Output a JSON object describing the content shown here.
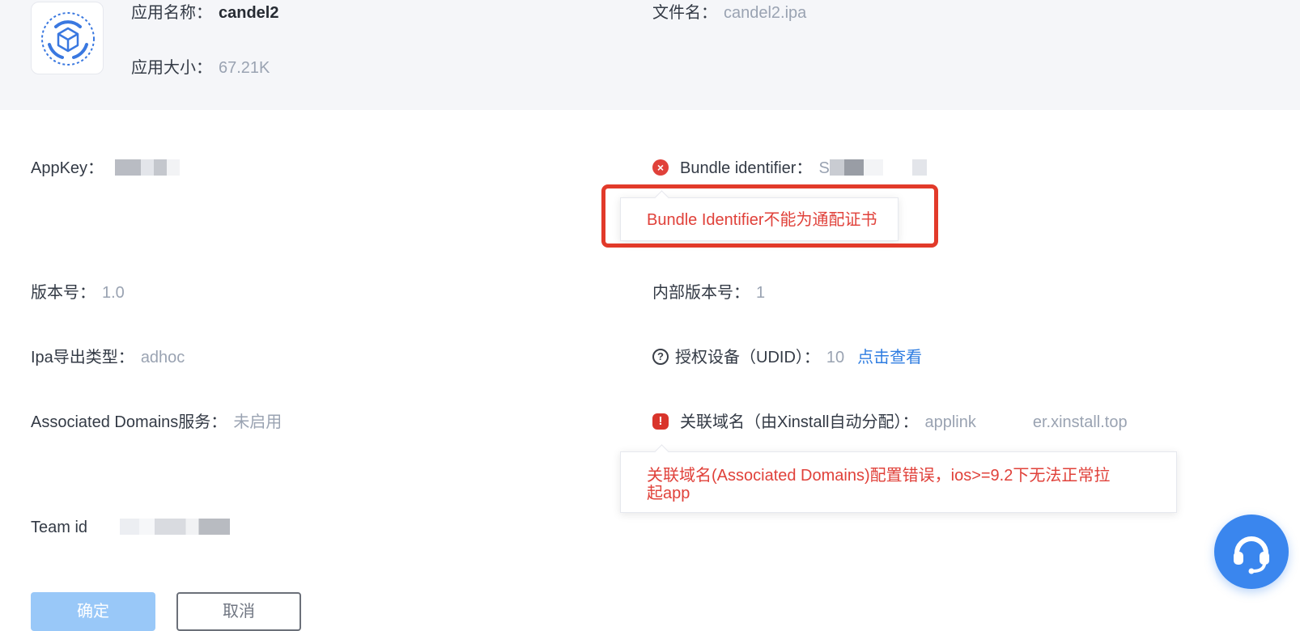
{
  "header": {
    "app_name_label": "应用名称：",
    "app_name_value": "candel2",
    "app_size_label": "应用大小：",
    "app_size_value": "67.21K",
    "file_name_label": "文件名：",
    "file_name_value": "candel2.ipa",
    "app_icon": "cube-logo-icon"
  },
  "details": {
    "appkey_label": "AppKey：",
    "bundle_label": "Bundle identifier：",
    "bundle_value_visible": "S",
    "bundle_error_tooltip": "Bundle Identifier不能为通配证书",
    "version_label": "版本号：",
    "version_value": "1.0",
    "build_label": "内部版本号：",
    "build_value": "1",
    "ipa_type_label": "Ipa导出类型：",
    "ipa_type_value": "adhoc",
    "udid_label": "授权设备（UDID）：",
    "udid_value": "10",
    "udid_link": "点击查看",
    "assoc_label": "Associated Domains服务：",
    "assoc_value": "未启用",
    "domain_label": "关联域名（由Xinstall自动分配）：",
    "domain_value_prefix": "applink",
    "domain_value_suffix": "er.xinstall.top",
    "domain_error_tooltip_line1": "关联域名(Associated Domains)配置错误，ios>=9.2下无法正常拉",
    "domain_error_tooltip_line2": "起app",
    "team_label": "Team id"
  },
  "buttons": {
    "confirm": "确定",
    "cancel": "取消"
  },
  "icons": {
    "error": "error-circle-icon",
    "warning": "warning-icon",
    "help": "help-circle-icon",
    "support": "headset-icon"
  },
  "colors": {
    "error": "#e0413a",
    "link": "#2f7de1",
    "primary": "#99c8f8",
    "support": "#3a86ee"
  }
}
